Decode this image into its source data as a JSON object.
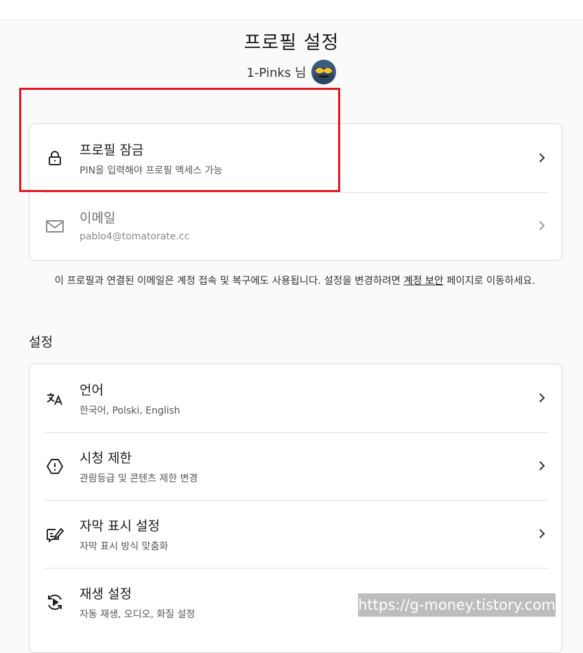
{
  "header": {
    "title": "프로필 설정",
    "profile_name": "1-Pinks 님"
  },
  "account_card": {
    "items": [
      {
        "label": "프로필 잠금",
        "desc": "PIN을 입력해야 프로필 액세스 가능",
        "icon": "lock-icon"
      },
      {
        "label": "이메일",
        "desc": "pablo4@tomatorate.cc",
        "icon": "mail-icon"
      }
    ]
  },
  "note": {
    "text_before": "이 프로필과 연결된 이메일은 계정 접속 및 복구에도 사용됩니다. 설정을 변경하려면 ",
    "link": "계정 보안",
    "text_after": " 페이지로 이동하세요."
  },
  "settings": {
    "section_title": "설정",
    "items": [
      {
        "label": "언어",
        "desc": "한국어, Polski, English",
        "icon": "language-icon"
      },
      {
        "label": "시청 제한",
        "desc": "관람등급 및 콘텐츠 제한 변경",
        "icon": "warning-octagon-icon"
      },
      {
        "label": "자막 표시 설정",
        "desc": "자막 표시 방식 맞춤화",
        "icon": "subtitle-edit-icon"
      },
      {
        "label": "재생 설정",
        "desc": "자동 재생, 오디오, 화질 설정",
        "icon": "playback-icon"
      }
    ]
  },
  "watermark": "https://g-money.tistory.com",
  "colors": {
    "highlight": "#e3151f",
    "background": "#fafafa"
  }
}
